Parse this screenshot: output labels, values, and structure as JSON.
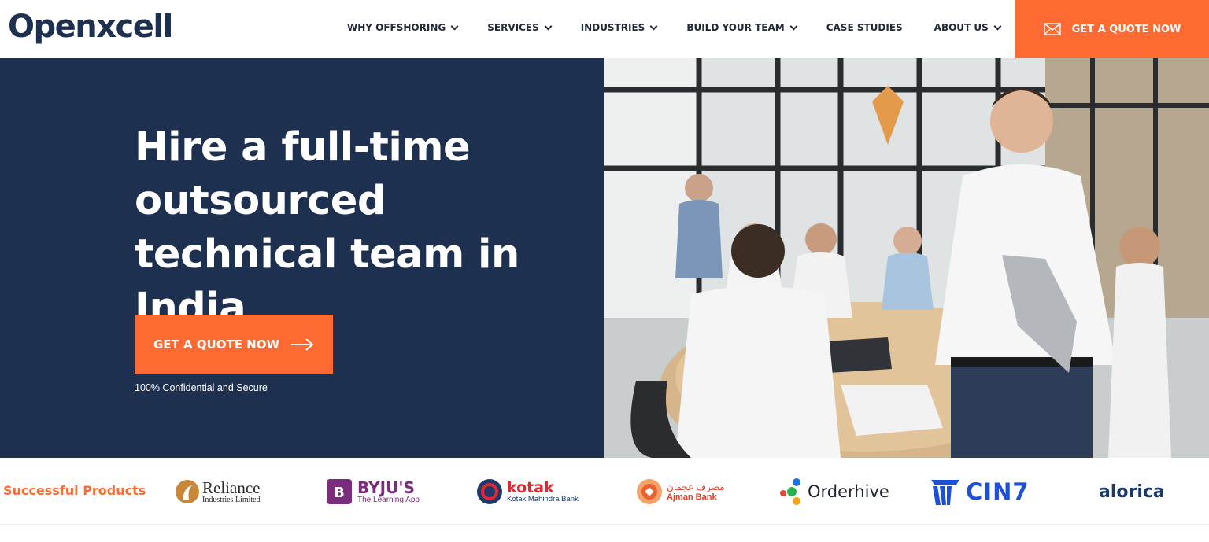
{
  "header": {
    "logo_text": "Openxcell",
    "nav": [
      {
        "label": "WHY OFFSHORING",
        "has_dropdown": true
      },
      {
        "label": "SERVICES",
        "has_dropdown": true
      },
      {
        "label": "INDUSTRIES",
        "has_dropdown": true
      },
      {
        "label": "BUILD YOUR TEAM",
        "has_dropdown": true
      },
      {
        "label": "CASE STUDIES",
        "has_dropdown": false
      },
      {
        "label": "ABOUT US",
        "has_dropdown": true
      }
    ],
    "search_icon": "search-icon",
    "cta_label": "GET A QUOTE NOW",
    "cta_icon": "envelope-icon"
  },
  "hero": {
    "title": "Hire a full-time outsourced technical team in India",
    "cta_label": "GET A QUOTE NOW",
    "cta_icon": "arrow-right-icon",
    "note": "100% Confidential and Secure"
  },
  "clients": {
    "label": "Successful Products",
    "reliance": {
      "name": "Reliance",
      "sub": "Industries Limited"
    },
    "byjus": {
      "name": "BYJU'S",
      "sub": "The Learning App"
    },
    "kotak": {
      "name": "kotak",
      "sub": "Kotak Mahindra Bank"
    },
    "ajman": {
      "name_ar": "مصرف عجمان",
      "name_en": "Ajman Bank"
    },
    "orderhive": {
      "name": "Orderhive"
    },
    "cin7": {
      "name": "CIN7"
    },
    "alorica": {
      "name": "alorica"
    }
  },
  "colors": {
    "navy": "#1e3050",
    "orange": "#ff6a32"
  }
}
